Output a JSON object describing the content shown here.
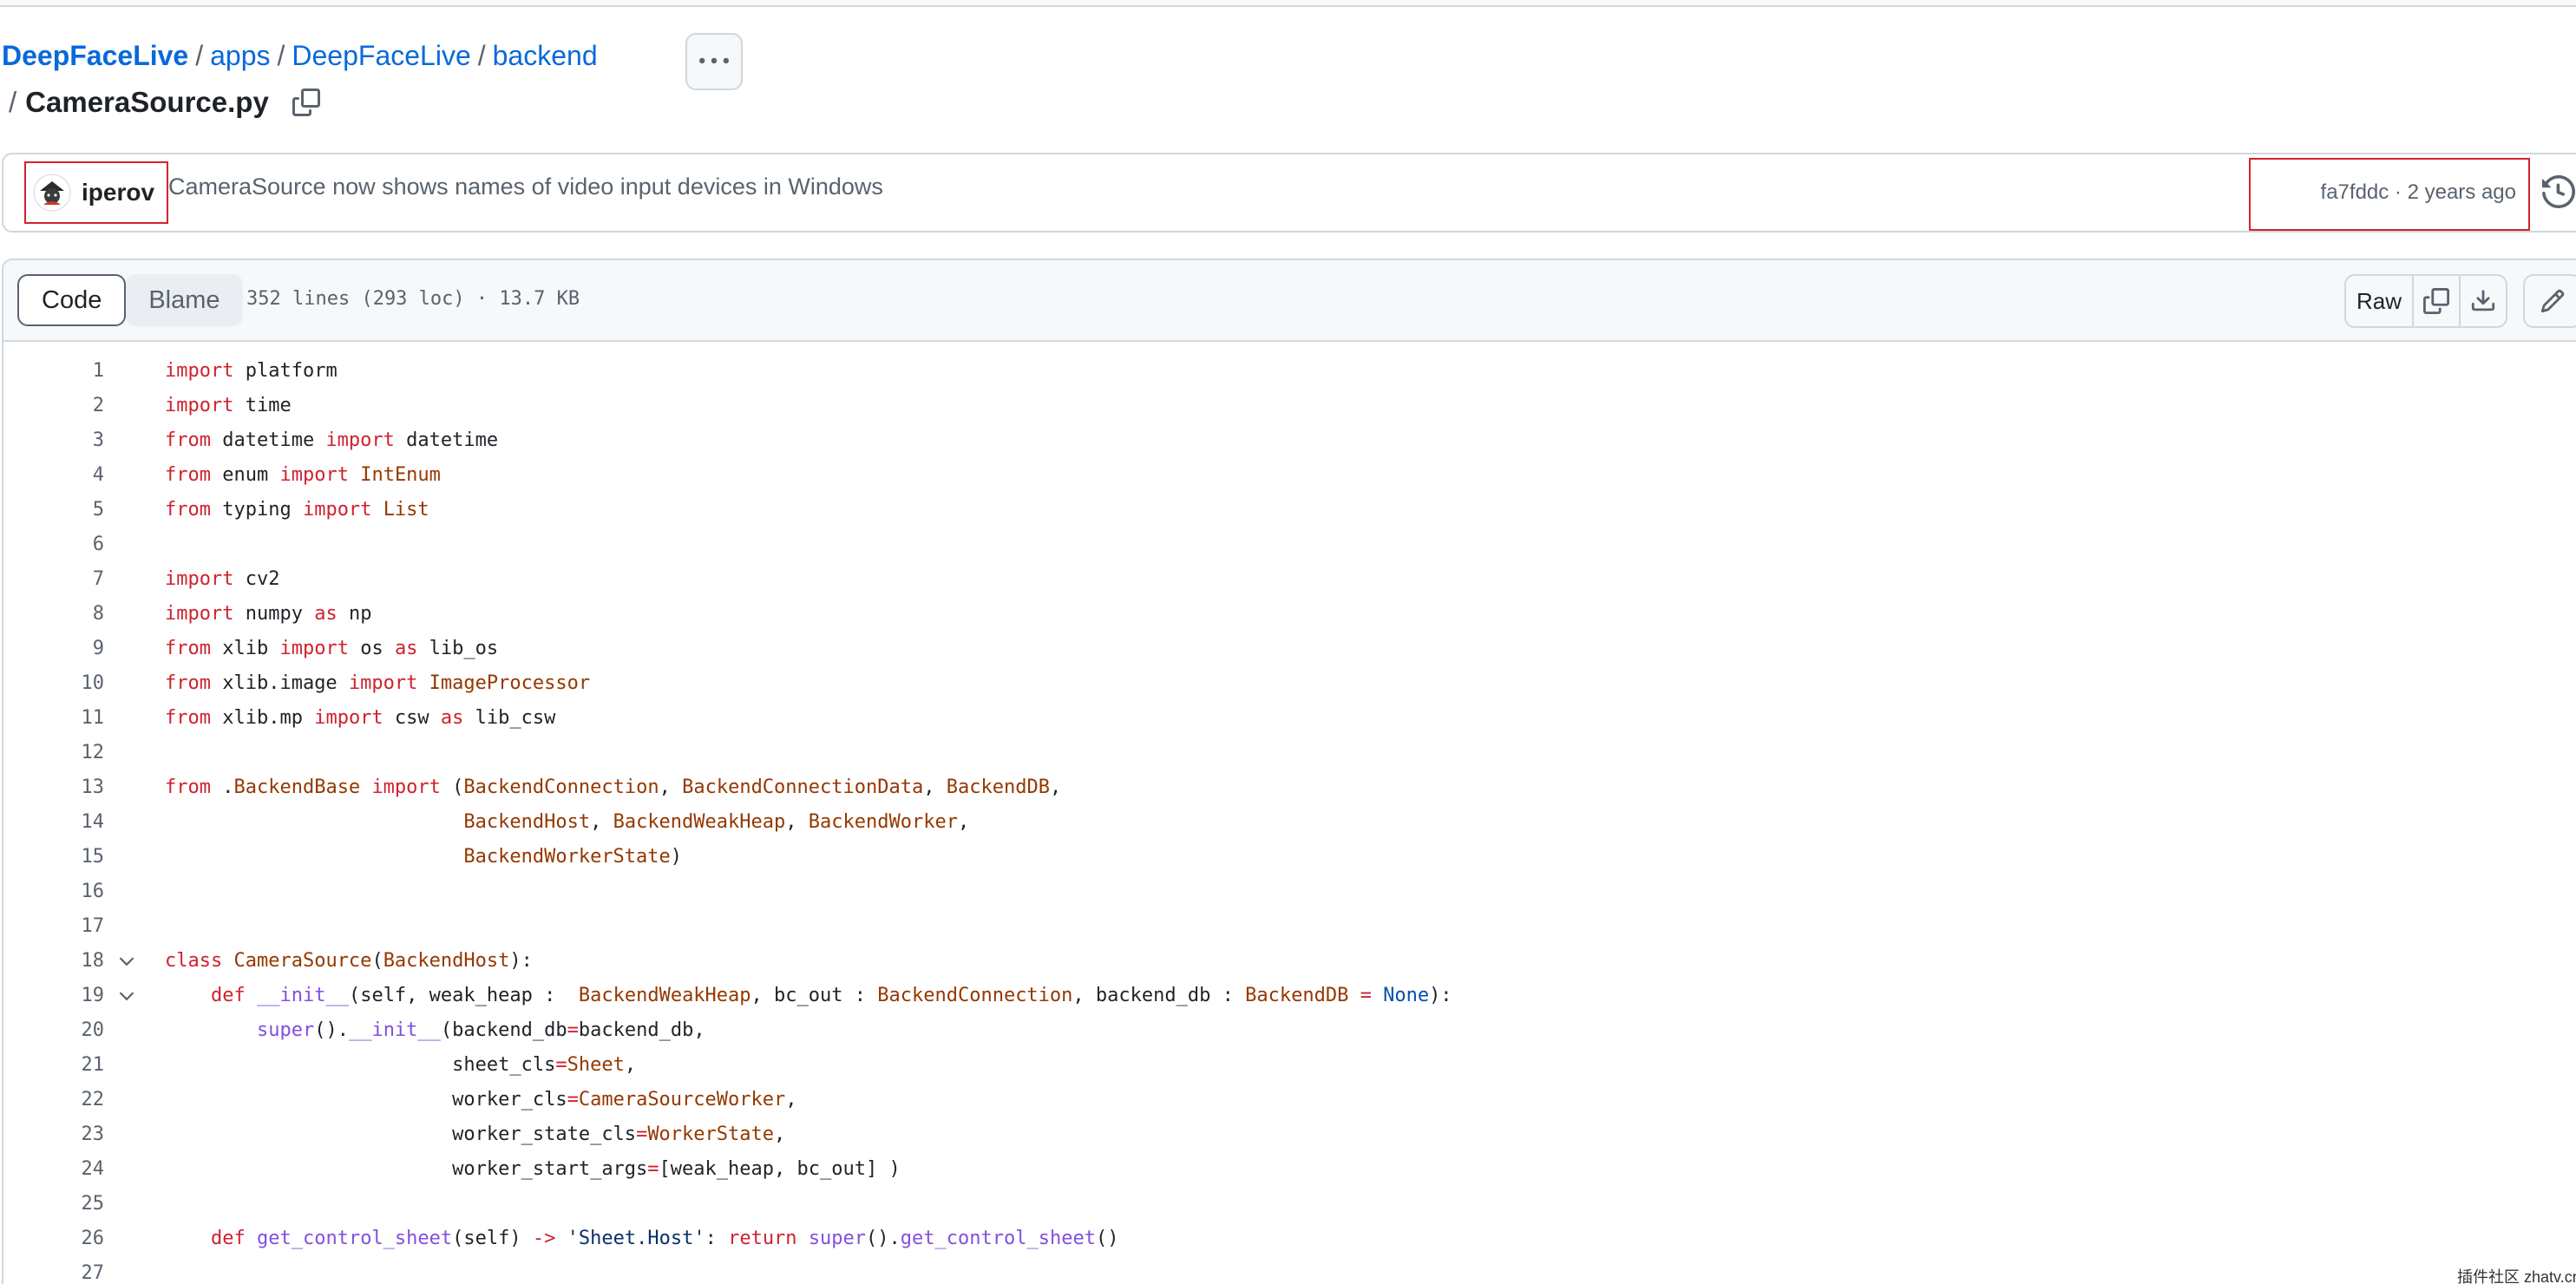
{
  "breadcrumb": {
    "repo": "DeepFaceLive",
    "parts": [
      "apps",
      "DeepFaceLive",
      "backend"
    ],
    "separator": "/",
    "file": "CameraSource.py"
  },
  "commit": {
    "author": "iperov",
    "message": "CameraSource now shows names of video input devices in Windows",
    "meta": "fa7fddc · 2 years ago"
  },
  "file_header": {
    "tabs": [
      "Code",
      "Blame"
    ],
    "info": "352 lines (293 loc) · 13.7 KB",
    "raw_label": "Raw"
  },
  "colors": {
    "accent_link": "#0969da",
    "highlight_box": "#d1242f",
    "keyword": "#cf222e",
    "type_name": "#953800",
    "function": "#8250df",
    "constant": "#0550ae"
  },
  "code": [
    {
      "n": "1",
      "tokens": [
        [
          "k",
          "import"
        ],
        [
          "p",
          " platform"
        ]
      ]
    },
    {
      "n": "2",
      "tokens": [
        [
          "k",
          "import"
        ],
        [
          "p",
          " time"
        ]
      ]
    },
    {
      "n": "3",
      "tokens": [
        [
          "k",
          "from"
        ],
        [
          "p",
          " datetime "
        ],
        [
          "k",
          "import"
        ],
        [
          "p",
          " datetime"
        ]
      ]
    },
    {
      "n": "4",
      "tokens": [
        [
          "k",
          "from"
        ],
        [
          "p",
          " enum "
        ],
        [
          "k",
          "import"
        ],
        [
          "p",
          " "
        ],
        [
          "n",
          "IntEnum"
        ]
      ]
    },
    {
      "n": "5",
      "tokens": [
        [
          "k",
          "from"
        ],
        [
          "p",
          " typing "
        ],
        [
          "k",
          "import"
        ],
        [
          "p",
          " "
        ],
        [
          "n",
          "List"
        ]
      ]
    },
    {
      "n": "6",
      "tokens": []
    },
    {
      "n": "7",
      "tokens": [
        [
          "k",
          "import"
        ],
        [
          "p",
          " cv2"
        ]
      ]
    },
    {
      "n": "8",
      "tokens": [
        [
          "k",
          "import"
        ],
        [
          "p",
          " numpy "
        ],
        [
          "k",
          "as"
        ],
        [
          "p",
          " np"
        ]
      ]
    },
    {
      "n": "9",
      "tokens": [
        [
          "k",
          "from"
        ],
        [
          "p",
          " xlib "
        ],
        [
          "k",
          "import"
        ],
        [
          "p",
          " os "
        ],
        [
          "k",
          "as"
        ],
        [
          "p",
          " lib_os"
        ]
      ]
    },
    {
      "n": "10",
      "tokens": [
        [
          "k",
          "from"
        ],
        [
          "p",
          " xlib.image "
        ],
        [
          "k",
          "import"
        ],
        [
          "p",
          " "
        ],
        [
          "n",
          "ImageProcessor"
        ]
      ]
    },
    {
      "n": "11",
      "tokens": [
        [
          "k",
          "from"
        ],
        [
          "p",
          " xlib.mp "
        ],
        [
          "k",
          "import"
        ],
        [
          "p",
          " csw "
        ],
        [
          "k",
          "as"
        ],
        [
          "p",
          " lib_csw"
        ]
      ]
    },
    {
      "n": "12",
      "tokens": []
    },
    {
      "n": "13",
      "tokens": [
        [
          "k",
          "from"
        ],
        [
          "p",
          " ."
        ],
        [
          "n",
          "BackendBase"
        ],
        [
          "p",
          " "
        ],
        [
          "k",
          "import"
        ],
        [
          "p",
          " ("
        ],
        [
          "n",
          "BackendConnection"
        ],
        [
          "p",
          ", "
        ],
        [
          "n",
          "BackendConnectionData"
        ],
        [
          "p",
          ", "
        ],
        [
          "n",
          "BackendDB"
        ],
        [
          "p",
          ","
        ]
      ]
    },
    {
      "n": "14",
      "tokens": [
        [
          "p",
          "                          "
        ],
        [
          "n",
          "BackendHost"
        ],
        [
          "p",
          ", "
        ],
        [
          "n",
          "BackendWeakHeap"
        ],
        [
          "p",
          ", "
        ],
        [
          "n",
          "BackendWorker"
        ],
        [
          "p",
          ","
        ]
      ]
    },
    {
      "n": "15",
      "tokens": [
        [
          "p",
          "                          "
        ],
        [
          "n",
          "BackendWorkerState"
        ],
        [
          "p",
          ")"
        ]
      ]
    },
    {
      "n": "16",
      "tokens": []
    },
    {
      "n": "17",
      "tokens": []
    },
    {
      "n": "18",
      "fold": true,
      "tokens": [
        [
          "k",
          "class"
        ],
        [
          "p",
          " "
        ],
        [
          "n",
          "CameraSource"
        ],
        [
          "p",
          "("
        ],
        [
          "n",
          "BackendHost"
        ],
        [
          "p",
          "):"
        ]
      ]
    },
    {
      "n": "19",
      "fold": true,
      "tokens": [
        [
          "p",
          "    "
        ],
        [
          "k",
          "def"
        ],
        [
          "p",
          " "
        ],
        [
          "f",
          "__init__"
        ],
        [
          "p",
          "(self, weak_heap :  "
        ],
        [
          "n",
          "BackendWeakHeap"
        ],
        [
          "p",
          ", bc_out : "
        ],
        [
          "n",
          "BackendConnection"
        ],
        [
          "p",
          ", backend_db : "
        ],
        [
          "n",
          "BackendDB"
        ],
        [
          "p",
          " "
        ],
        [
          "k",
          "="
        ],
        [
          "p",
          " "
        ],
        [
          "c",
          "None"
        ],
        [
          "p",
          "):"
        ]
      ]
    },
    {
      "n": "20",
      "tokens": [
        [
          "p",
          "        "
        ],
        [
          "f",
          "super"
        ],
        [
          "p",
          "()."
        ],
        [
          "f",
          "__init__"
        ],
        [
          "p",
          "(backend_db"
        ],
        [
          "k",
          "="
        ],
        [
          "p",
          "backend_db,"
        ]
      ]
    },
    {
      "n": "21",
      "tokens": [
        [
          "p",
          "                         sheet_cls"
        ],
        [
          "k",
          "="
        ],
        [
          "n",
          "Sheet"
        ],
        [
          "p",
          ","
        ]
      ]
    },
    {
      "n": "22",
      "tokens": [
        [
          "p",
          "                         worker_cls"
        ],
        [
          "k",
          "="
        ],
        [
          "n",
          "CameraSourceWorker"
        ],
        [
          "p",
          ","
        ]
      ]
    },
    {
      "n": "23",
      "tokens": [
        [
          "p",
          "                         worker_state_cls"
        ],
        [
          "k",
          "="
        ],
        [
          "n",
          "WorkerState"
        ],
        [
          "p",
          ","
        ]
      ]
    },
    {
      "n": "24",
      "tokens": [
        [
          "p",
          "                         worker_start_args"
        ],
        [
          "k",
          "="
        ],
        [
          "p",
          "[weak_heap, bc_out] )"
        ]
      ]
    },
    {
      "n": "25",
      "tokens": []
    },
    {
      "n": "26",
      "tokens": [
        [
          "p",
          "    "
        ],
        [
          "k",
          "def"
        ],
        [
          "p",
          " "
        ],
        [
          "f",
          "get_control_sheet"
        ],
        [
          "p",
          "(self) "
        ],
        [
          "k",
          "->"
        ],
        [
          "p",
          " "
        ],
        [
          "s",
          "'Sheet.Host'"
        ],
        [
          "p",
          ": "
        ],
        [
          "k",
          "return"
        ],
        [
          "p",
          " "
        ],
        [
          "f",
          "super"
        ],
        [
          "p",
          "()."
        ],
        [
          "f",
          "get_control_sheet"
        ],
        [
          "p",
          "()"
        ]
      ]
    },
    {
      "n": "27",
      "tokens": []
    }
  ],
  "watermark": "插件社区 zhatv.cn"
}
